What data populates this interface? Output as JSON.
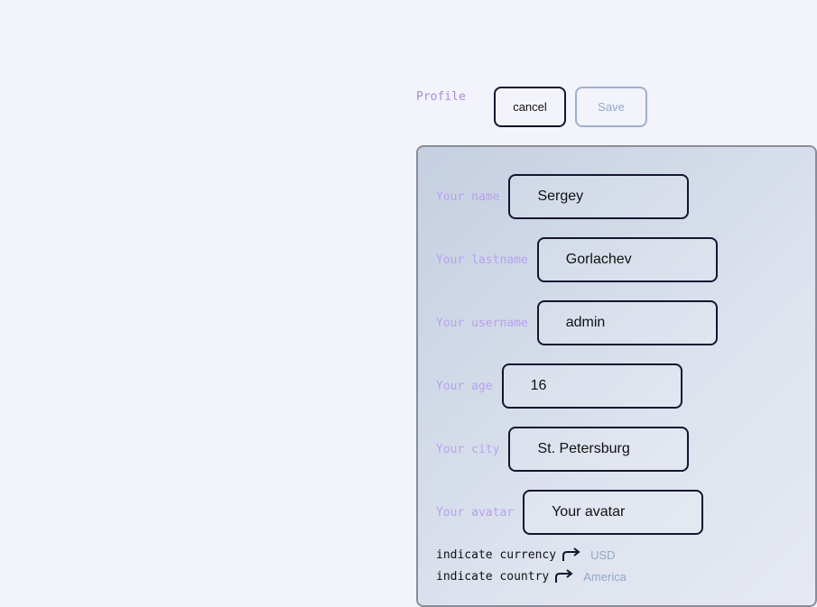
{
  "header": {
    "title": "Profile",
    "cancel_label": "cancel",
    "save_label": "Save"
  },
  "form": {
    "fields": [
      {
        "label": "Your name",
        "value": "Sergey"
      },
      {
        "label": "Your lastname",
        "value": "Gorlachev"
      },
      {
        "label": "Your username",
        "value": "admin"
      },
      {
        "label": "Your age",
        "value": "16"
      },
      {
        "label": "Your city",
        "value": "St. Petersburg"
      },
      {
        "label": "Your avatar",
        "value": "Your avatar"
      }
    ],
    "currency": {
      "label": "indicate currency",
      "value": "USD",
      "icon": "arrow-forward-icon"
    },
    "country": {
      "label": "indicate country",
      "value": "America",
      "icon": "arrow-forward-icon"
    }
  },
  "colors": {
    "background": "#f3f3fc",
    "label_accent": "#b8a1f0",
    "border_dark": "#151530",
    "muted_blue": "#93a8c8"
  }
}
